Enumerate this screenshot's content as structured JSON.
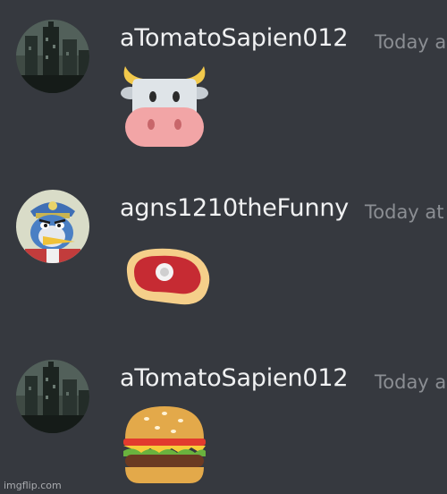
{
  "messages": [
    {
      "username": "aTomatoSapien012",
      "timestamp": "Today a",
      "avatar_icon": "city-skyline-avatar",
      "emoji": "cow-face-emoji"
    },
    {
      "username": "agns1210theFunny",
      "timestamp": "Today at",
      "avatar_icon": "penguin-king-avatar",
      "emoji": "cut-of-meat-emoji"
    },
    {
      "username": "aTomatoSapien012",
      "timestamp": "Today a",
      "avatar_icon": "city-skyline-avatar",
      "emoji": "hamburger-emoji"
    }
  ],
  "watermark": "imgflip.com",
  "colors": {
    "background": "#36393f",
    "username": "#f0f1f2",
    "timestamp": "#8b8e93"
  }
}
